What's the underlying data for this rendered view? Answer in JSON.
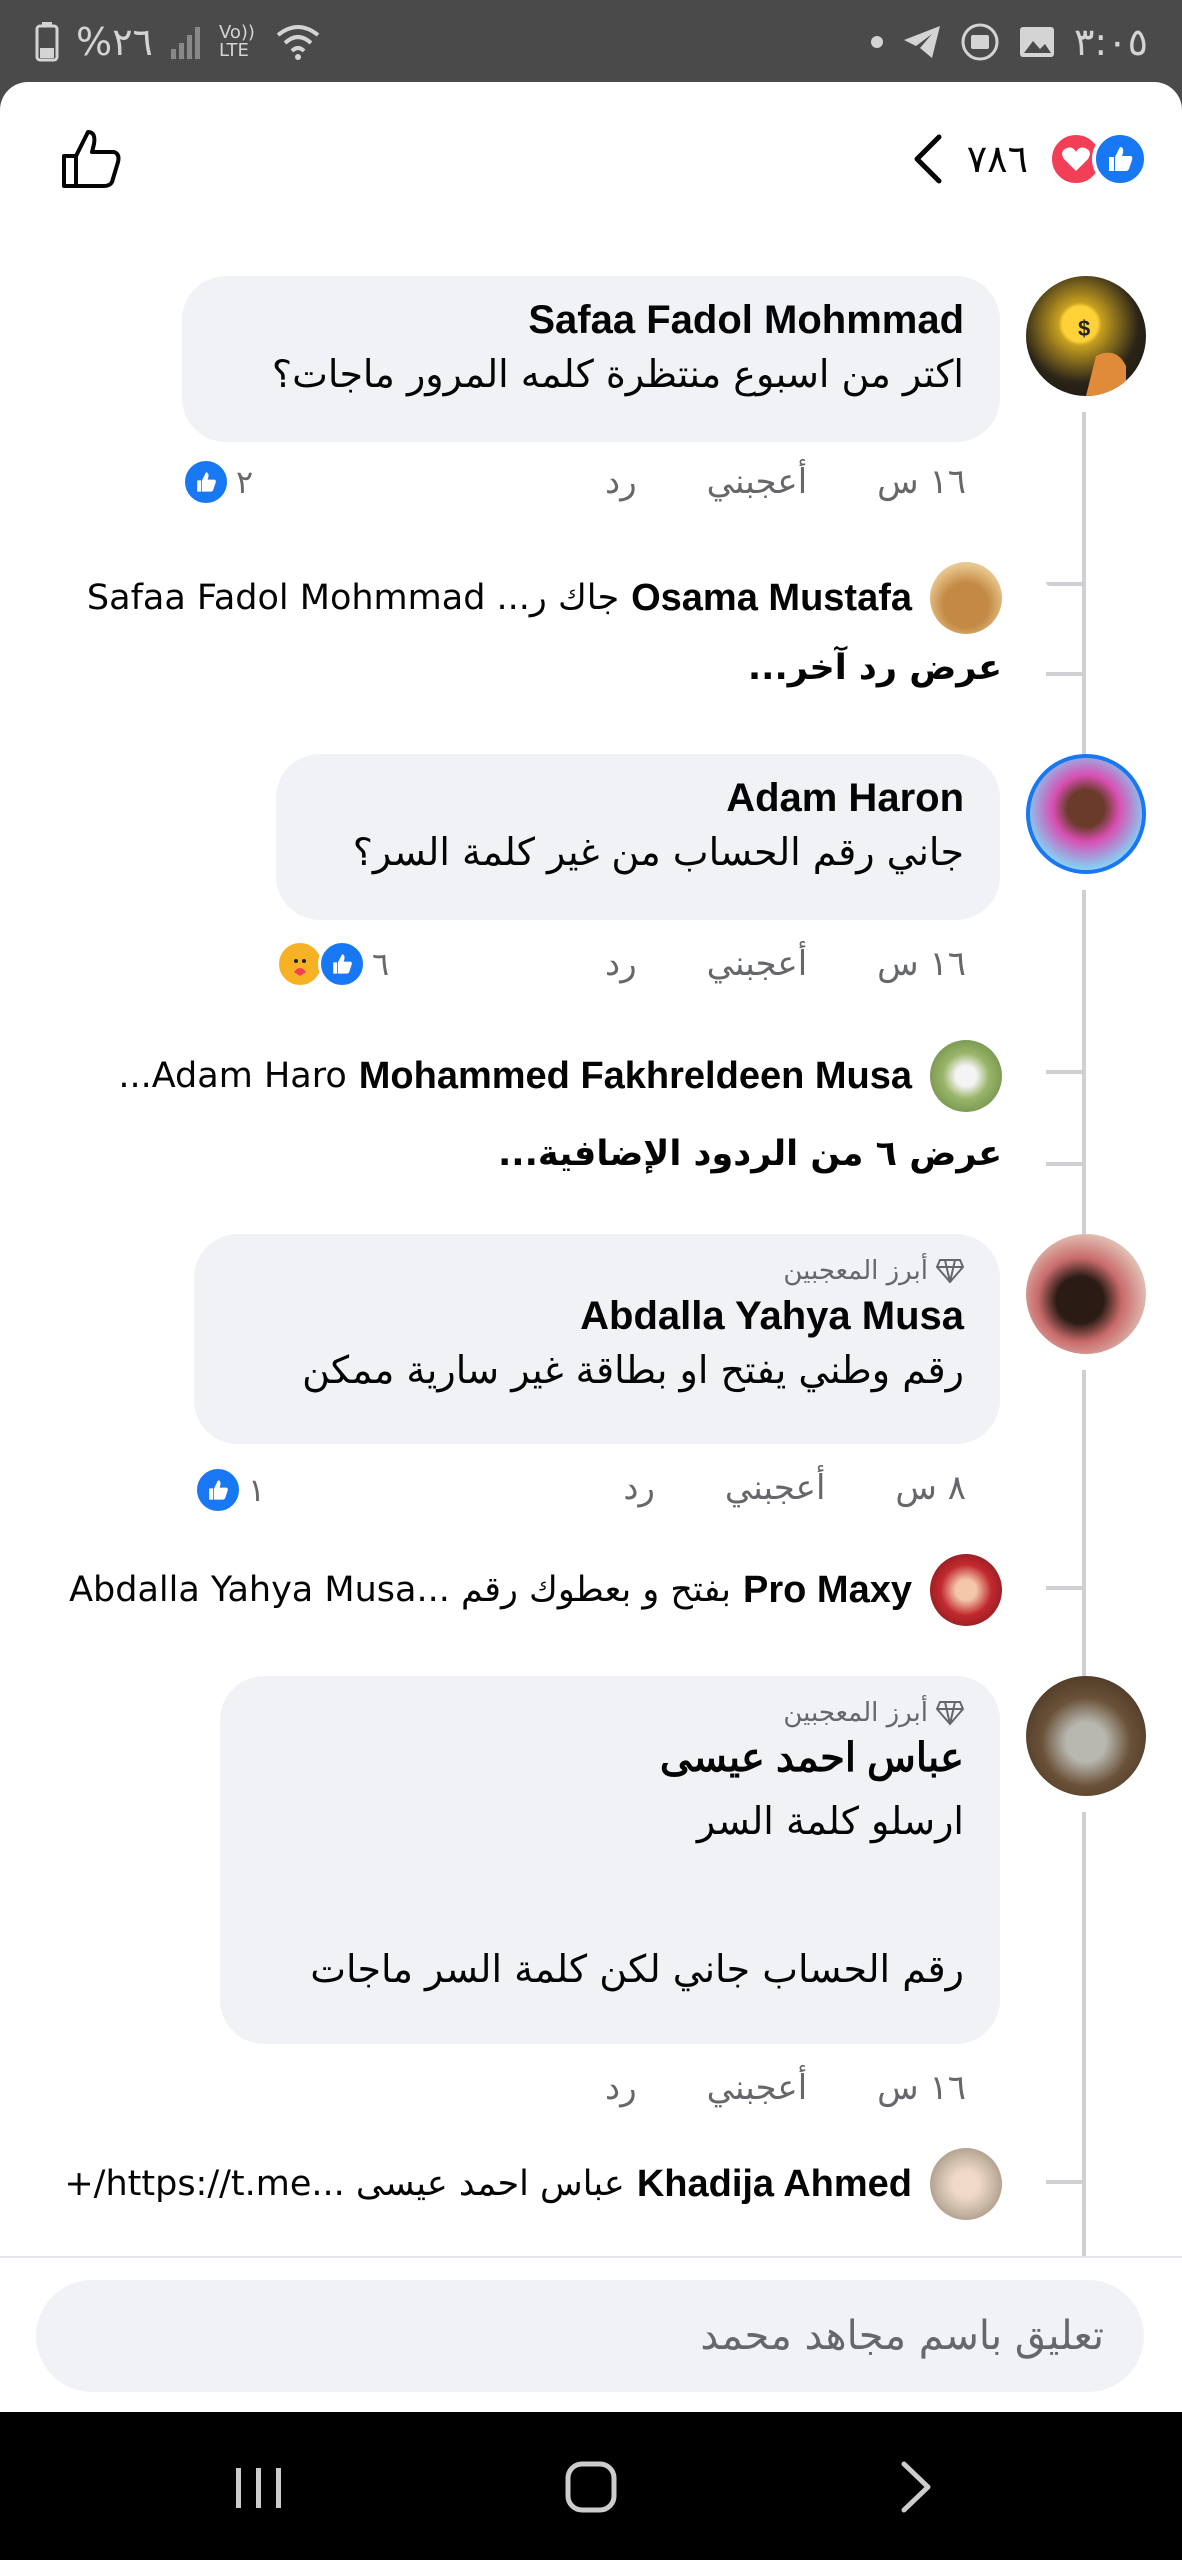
{
  "status_bar": {
    "time": "٣:٠٥",
    "battery": "%٢٦",
    "network": "Vo)) LTE"
  },
  "header": {
    "reaction_count": "٧٨٦"
  },
  "comments": [
    {
      "name": "Safaa Fadol Mohmmad",
      "badge": "",
      "text": "اكتر من اسبوع منتظرة كلمه المرور ماجات؟",
      "time": "١٦ س",
      "like": "أعجبني",
      "reply": "رد",
      "reaction_count": "٢",
      "reply_preview": {
        "name": "Osama Mustafa",
        "text": "جاك ر... Safaa Fadol Mohmmad"
      },
      "more_replies": "عرض رد آخر..."
    },
    {
      "name": "Adam Haron",
      "badge": "",
      "text": "جاني رقم الحساب من غير كلمة السر؟",
      "time": "١٦ س",
      "like": "أعجبني",
      "reply": "رد",
      "reaction_count": "٦",
      "reply_preview": {
        "name": "Mohammed Fakhreldeen Musa",
        "text": "Adam Haro..."
      },
      "more_replies": "عرض ٦ من الردود الإضافية..."
    },
    {
      "name": "Abdalla Yahya Musa",
      "badge": "أبرز المعجبين",
      "text": "رقم وطني يفتح او بطاقة غير سارية ممكن",
      "time": "٨ س",
      "like": "أعجبني",
      "reply": "رد",
      "reaction_count": "١",
      "reply_preview": {
        "name": "Pro Maxy",
        "text": "بفتح و بعطوك رقم ...Abdalla Yahya Musa"
      },
      "more_replies": ""
    },
    {
      "name": "عباس احمد عيسى",
      "badge": "أبرز المعجبين",
      "text": "ارسلو  كلمة السر\n\nرقم الحساب جاني  لكن كلمة السر ماجات",
      "time": "١٦ س",
      "like": "أعجبني",
      "reply": "رد",
      "reaction_count": "",
      "reply_preview": {
        "name": "Khadija Ahmed",
        "text": "عباس احمد عيسى ...https://t.me/+"
      },
      "more_replies": ""
    }
  ],
  "composer": {
    "placeholder": "تعليق باسم مجاهد محمد"
  },
  "colors": {
    "fb_blue": "#1877f2",
    "love_red": "#f33e58",
    "bubble_bg": "#f0f2f5",
    "secondary_text": "#65676b"
  }
}
